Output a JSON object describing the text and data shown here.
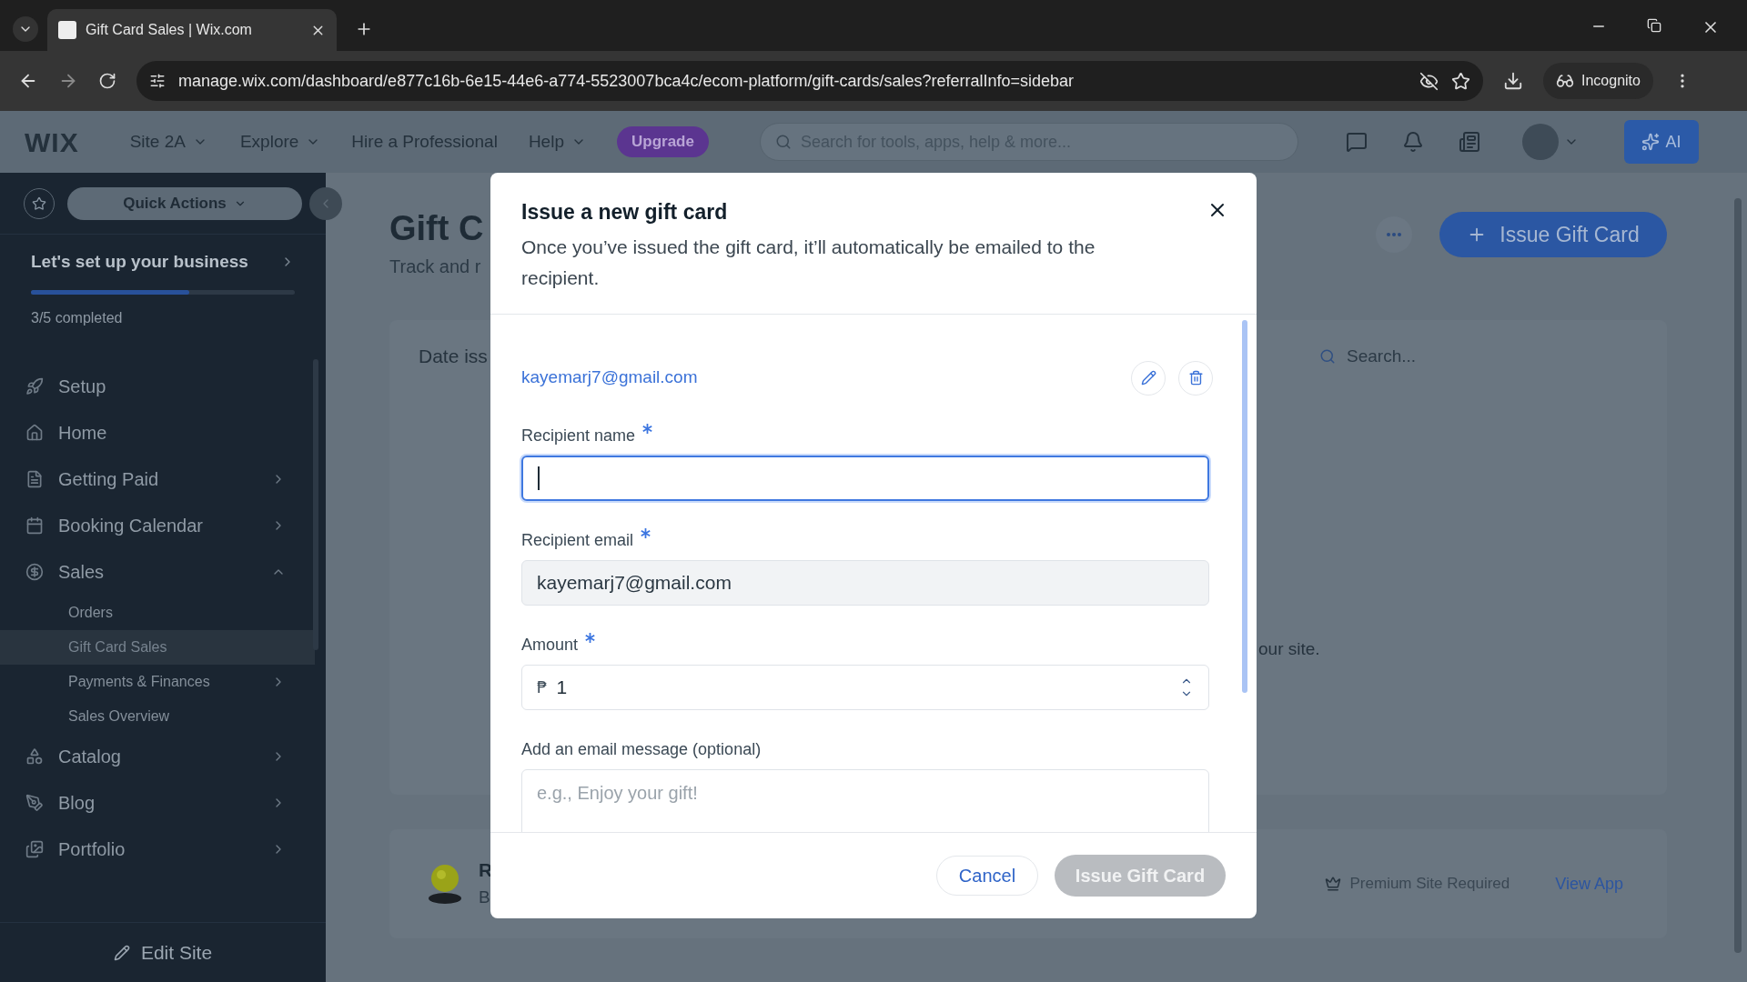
{
  "browser": {
    "tab_title": "Gift Card Sales | Wix.com",
    "url": "manage.wix.com/dashboard/e877c16b-6e15-44e6-a774-5523007bca4c/ecom-platform/gift-cards/sales?referralInfo=sidebar",
    "incognito_label": "Incognito"
  },
  "topbar": {
    "logo": "WIX",
    "site_menu": "Site 2A",
    "nav": [
      {
        "label": "Explore",
        "dropdown": true
      },
      {
        "label": "Hire a Professional",
        "dropdown": false
      },
      {
        "label": "Help",
        "dropdown": true
      }
    ],
    "upgrade": "Upgrade",
    "search_placeholder": "Search for tools, apps, help & more...",
    "ai_label": "AI"
  },
  "sidebar": {
    "quick_actions": "Quick Actions",
    "setup": {
      "title": "Let's set up your business",
      "level": 0.6,
      "progress_text": "3/5 completed"
    },
    "items": [
      {
        "label": "Setup",
        "expandable": false
      },
      {
        "label": "Home",
        "expandable": false
      },
      {
        "label": "Getting Paid",
        "expandable": true,
        "expanded": false
      },
      {
        "label": "Booking Calendar",
        "expandable": true,
        "expanded": false
      },
      {
        "label": "Sales",
        "expandable": true,
        "expanded": true,
        "children": [
          {
            "label": "Orders",
            "selected": false,
            "expandable": false
          },
          {
            "label": "Gift Card Sales",
            "selected": true,
            "expandable": false
          },
          {
            "label": "Payments & Finances",
            "selected": false,
            "expandable": true
          },
          {
            "label": "Sales Overview",
            "selected": false,
            "expandable": false
          }
        ]
      },
      {
        "label": "Catalog",
        "expandable": true,
        "expanded": false
      },
      {
        "label": "Blog",
        "expandable": true,
        "expanded": false
      },
      {
        "label": "Portfolio",
        "expandable": true,
        "expanded": false
      }
    ],
    "edit_site": "Edit Site"
  },
  "page": {
    "title": "Gift C",
    "subtitle": "Track and r",
    "issue_button": "Issue Gift Card",
    "filter_label": "Date iss",
    "search_placeholder": "Search...",
    "empty_text": "our site.",
    "app_card": {
      "title": "R",
      "subtitle": "B",
      "premium_text": "Premium Site Required",
      "link": "View App"
    }
  },
  "dialog": {
    "title": "Issue a new gift card",
    "description": "Once you’ve issued the gift card, it’ll automatically be emailed to the recipient.",
    "recipient": "kayemarj7@gmail.com",
    "fields": [
      {
        "kind": "text",
        "label": "Recipient name",
        "required": true,
        "focused": true,
        "readonly": false
      },
      {
        "kind": "text",
        "label": "Recipient email",
        "required": true,
        "focused": false,
        "readonly": true,
        "value": "kayemarj7@gmail.com"
      },
      {
        "kind": "number",
        "label": "Amount",
        "required": true,
        "focused": false,
        "readonly": false,
        "currency": "₱",
        "value": "1"
      },
      {
        "kind": "textarea",
        "label": "Add an email message (optional)",
        "required": false,
        "focused": false,
        "readonly": false,
        "placeholder": "e.g., Enjoy your gift!"
      }
    ],
    "cancel": "Cancel",
    "submit": {
      "label": "Issue Gift Card",
      "disabled": true
    }
  }
}
